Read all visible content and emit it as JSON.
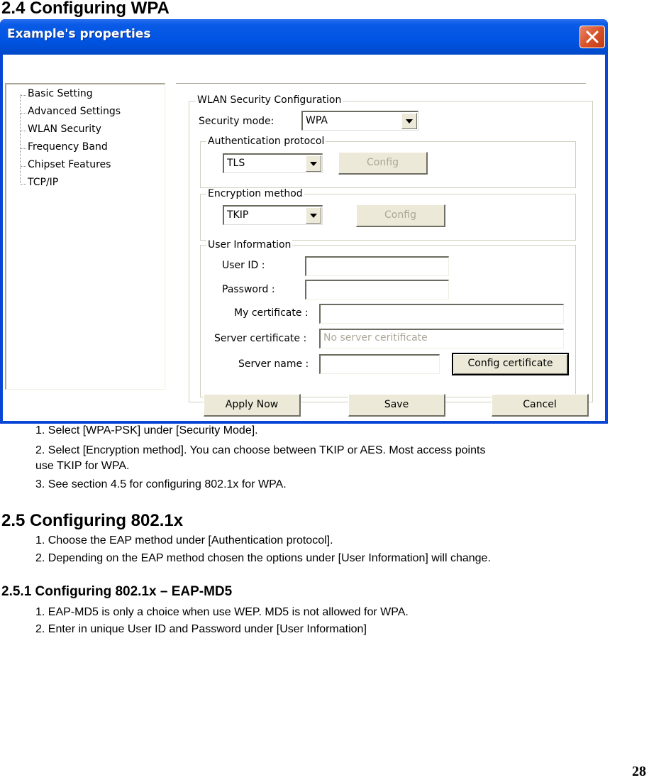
{
  "doc": {
    "section_2_4_title": "2.4 Configuring WPA",
    "section_2_4_steps": [
      "1. Select [WPA-PSK] under [Security Mode].",
      "2. Select [Encryption method]. You can choose between TKIP or AES. Most access points",
      "use TKIP for WPA.",
      "3. See section 4.5 for configuring 802.1x for WPA."
    ],
    "section_2_5_title": "2.5 Configuring 802.1x",
    "section_2_5_steps": [
      "1. Choose the EAP method under [Authentication protocol].",
      "2. Depending on the EAP method chosen the options under [User Information] will change."
    ],
    "section_2_5_1_title": "2.5.1 Configuring 802.1x – EAP-MD5",
    "section_2_5_1_steps": [
      "1. EAP-MD5 is only a choice when use WEP. MD5 is not allowed for WPA.",
      "2. Enter in unique User ID and Password under [User Information]"
    ],
    "page_number": "28"
  },
  "window": {
    "title": "Example's properties",
    "close_icon": "close-x-icon",
    "titlebar_color": "#0054E3",
    "tree": {
      "items": [
        {
          "label": "Basic Setting"
        },
        {
          "label": "Advanced Settings"
        },
        {
          "label": "WLAN Security"
        },
        {
          "label": "Frequency Band"
        },
        {
          "label": "Chipset Features"
        },
        {
          "label": "TCP/IP"
        }
      ]
    },
    "wlan_security": {
      "group_label": "WLAN Security Configuration",
      "security_mode_label": "Security mode:",
      "security_mode_value": "WPA",
      "auth": {
        "group_label": "Authentication protocol",
        "value": "TLS",
        "config_label": "Config"
      },
      "encryption": {
        "group_label": "Encryption method",
        "value": "TKIP",
        "config_label": "Config"
      },
      "user_info": {
        "group_label": "User Information",
        "user_id_label": "User ID :",
        "user_id_value": "",
        "password_label": "Password :",
        "password_value": "",
        "my_cert_label": "My certificate :",
        "my_cert_value": "",
        "server_cert_label": "Server certificate :",
        "server_cert_placeholder": "No server ceritificate",
        "server_name_label": "Server name :",
        "server_name_value": "",
        "config_cert_label": "Config certificate"
      }
    },
    "buttons": {
      "apply": "Apply Now",
      "save": "Save",
      "cancel": "Cancel"
    }
  }
}
